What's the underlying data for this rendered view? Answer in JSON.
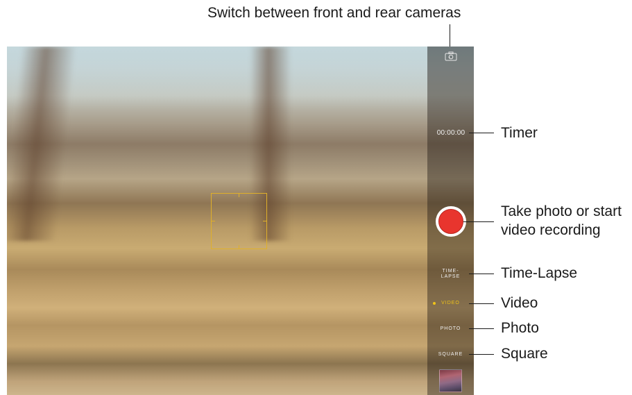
{
  "camera": {
    "timer": "00:00:00",
    "modes": [
      {
        "label_line1": "TIME-",
        "label_line2": "LAPSE",
        "active": false
      },
      {
        "label": "VIDEO",
        "active": true
      },
      {
        "label": "PHOTO",
        "active": false
      },
      {
        "label": "SQUARE",
        "active": false
      }
    ],
    "shutter_color": "#e8352e",
    "active_mode_color": "#f0c419",
    "focus_color": "#e0b02a",
    "icons": {
      "switch_camera": "camera-switch-icon",
      "shutter": "record-button",
      "thumbnail": "last-photo-thumbnail"
    }
  },
  "callouts": {
    "switch_cameras": "Switch between front and rear cameras",
    "timer": "Timer",
    "shutter_line1": "Take photo or start",
    "shutter_line2": "video recording",
    "time_lapse": "Time-Lapse",
    "video": "Video",
    "photo": "Photo",
    "square": "Square"
  }
}
